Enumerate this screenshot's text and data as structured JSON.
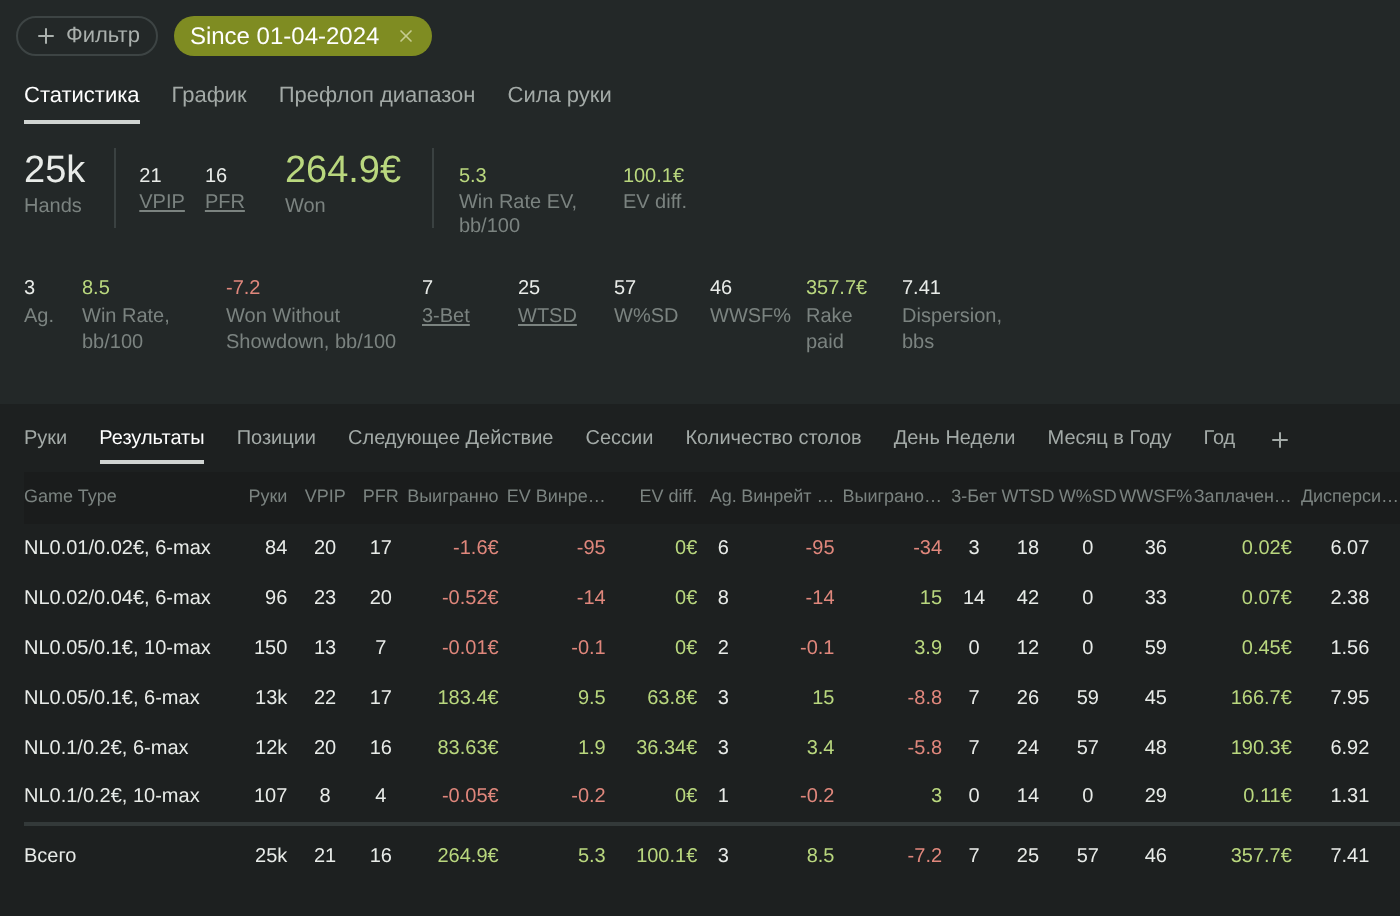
{
  "toolbar": {
    "filter_button": "Фильтр",
    "chip": {
      "label": "Since 01-04-2024"
    }
  },
  "view_tabs": [
    {
      "label": "Статистика",
      "selected": true
    },
    {
      "label": "График",
      "selected": false
    },
    {
      "label": "Префлоп диапазон",
      "selected": false
    },
    {
      "label": "Сила руки",
      "selected": false
    }
  ],
  "summary_top": [
    {
      "value": "25k",
      "label": "Hands",
      "kind": "large",
      "link": false,
      "divider_after": true
    },
    {
      "value": "21",
      "label": "VPIP",
      "kind": "small",
      "link": true,
      "divider_after": false
    },
    {
      "value": "16",
      "label": "PFR",
      "kind": "small",
      "link": true,
      "divider_after": false
    },
    {
      "value": "264.9€",
      "label": "Won",
      "kind": "large",
      "color": "#b9d77e",
      "link": false,
      "divider_after": true
    },
    {
      "value": "5.3",
      "label": "Win Rate EV, bb/100",
      "kind": "small",
      "color": "#b9d77e",
      "link": false,
      "divider_after": false
    },
    {
      "value": "100.1€",
      "label": "EV diff.",
      "kind": "small",
      "color": "#b9d77e",
      "link": false,
      "divider_after": false
    }
  ],
  "summary_bottom": [
    {
      "value": "3",
      "label": "Ag.",
      "link": false
    },
    {
      "value": "8.5",
      "label": "Win Rate, bb/100",
      "color": "#b9d77e",
      "link": false
    },
    {
      "value": "-7.2",
      "label": "Won Without Showdown, bb/100",
      "color": "#e0877c",
      "link": false
    },
    {
      "value": "7",
      "label": "3-Bet",
      "link": true
    },
    {
      "value": "25",
      "label": "WTSD",
      "link": true
    },
    {
      "value": "57",
      "label": "W%SD",
      "link": false
    },
    {
      "value": "46",
      "label": "WWSF%",
      "link": false
    },
    {
      "value": "357.7€",
      "label": "Rake paid",
      "color": "#b9d77e",
      "link": false
    },
    {
      "value": "7.41",
      "label": "Dispersion, bbs",
      "link": false
    }
  ],
  "report_tabs": [
    {
      "label": "Руки",
      "selected": false
    },
    {
      "label": "Результаты",
      "selected": true
    },
    {
      "label": "Позиции",
      "selected": false
    },
    {
      "label": "Следующее Действие",
      "selected": false
    },
    {
      "label": "Сессии",
      "selected": false
    },
    {
      "label": "Количество столов",
      "selected": false
    },
    {
      "label": "День Недели",
      "selected": false
    },
    {
      "label": "Месяц в Году",
      "selected": false
    },
    {
      "label": "Год",
      "selected": false
    }
  ],
  "table": {
    "columns": [
      "Game Type",
      "Руки",
      "VPIP",
      "PFR",
      "Выигранно",
      "EV Винре…",
      "EV diff.",
      "Ag.",
      "Винрейт …",
      "Выиграно…",
      "3-Бет",
      "WTSD",
      "W%SD",
      "WWSF%",
      "Заплачен…",
      "Дисперси…"
    ],
    "rows": [
      [
        "NL0.01/0.02€, 6-max",
        "84",
        "20",
        "17",
        {
          "text": "-1.6€",
          "color": "#e0877c"
        },
        {
          "text": "-95",
          "color": "#e0877c"
        },
        {
          "text": "0€",
          "color": "#b9d77e"
        },
        "6",
        {
          "text": "-95",
          "color": "#e0877c"
        },
        {
          "text": "-34",
          "color": "#e0877c"
        },
        "3",
        "18",
        "0",
        "36",
        {
          "text": "0.02€",
          "color": "#b9d77e"
        },
        "6.07"
      ],
      [
        "NL0.02/0.04€, 6-max",
        "96",
        "23",
        "20",
        {
          "text": "-0.52€",
          "color": "#e0877c"
        },
        {
          "text": "-14",
          "color": "#e0877c"
        },
        {
          "text": "0€",
          "color": "#b9d77e"
        },
        "8",
        {
          "text": "-14",
          "color": "#e0877c"
        },
        {
          "text": "15",
          "color": "#b9d77e"
        },
        "14",
        "42",
        "0",
        "33",
        {
          "text": "0.07€",
          "color": "#b9d77e"
        },
        "2.38"
      ],
      [
        "NL0.05/0.1€, 10-max",
        "150",
        "13",
        "7",
        {
          "text": "-0.01€",
          "color": "#e0877c"
        },
        {
          "text": "-0.1",
          "color": "#e0877c"
        },
        {
          "text": "0€",
          "color": "#b9d77e"
        },
        "2",
        {
          "text": "-0.1",
          "color": "#e0877c"
        },
        {
          "text": "3.9",
          "color": "#b9d77e"
        },
        "0",
        "12",
        "0",
        "59",
        {
          "text": "0.45€",
          "color": "#b9d77e"
        },
        "1.56"
      ],
      [
        "NL0.05/0.1€, 6-max",
        "13k",
        "22",
        "17",
        {
          "text": "183.4€",
          "color": "#b9d77e"
        },
        {
          "text": "9.5",
          "color": "#b9d77e"
        },
        {
          "text": "63.8€",
          "color": "#b9d77e"
        },
        "3",
        {
          "text": "15",
          "color": "#b9d77e"
        },
        {
          "text": "-8.8",
          "color": "#e0877c"
        },
        "7",
        "26",
        "59",
        "45",
        {
          "text": "166.7€",
          "color": "#b9d77e"
        },
        "7.95"
      ],
      [
        "NL0.1/0.2€, 6-max",
        "12k",
        "20",
        "16",
        {
          "text": "83.63€",
          "color": "#b9d77e"
        },
        {
          "text": "1.9",
          "color": "#b9d77e"
        },
        {
          "text": "36.34€",
          "color": "#b9d77e"
        },
        "3",
        {
          "text": "3.4",
          "color": "#b9d77e"
        },
        {
          "text": "-5.8",
          "color": "#e0877c"
        },
        "7",
        "24",
        "57",
        "48",
        {
          "text": "190.3€",
          "color": "#b9d77e"
        },
        "6.92"
      ],
      [
        "NL0.1/0.2€, 10-max",
        "107",
        "8",
        "4",
        {
          "text": "-0.05€",
          "color": "#e0877c"
        },
        {
          "text": "-0.2",
          "color": "#e0877c"
        },
        {
          "text": "0€",
          "color": "#b9d77e"
        },
        "1",
        {
          "text": "-0.2",
          "color": "#e0877c"
        },
        {
          "text": "3",
          "color": "#b9d77e"
        },
        "0",
        "14",
        "0",
        "29",
        {
          "text": "0.11€",
          "color": "#b9d77e"
        },
        "1.31"
      ]
    ],
    "total": [
      "Всего",
      "25k",
      "21",
      "16",
      {
        "text": "264.9€",
        "color": "#b9d77e"
      },
      {
        "text": "5.3",
        "color": "#b9d77e"
      },
      {
        "text": "100.1€",
        "color": "#b9d77e"
      },
      "3",
      {
        "text": "8.5",
        "color": "#b9d77e"
      },
      {
        "text": "-7.2",
        "color": "#e0877c"
      },
      "7",
      "25",
      "57",
      "46",
      {
        "text": "357.7€",
        "color": "#b9d77e"
      },
      "7.41"
    ]
  }
}
